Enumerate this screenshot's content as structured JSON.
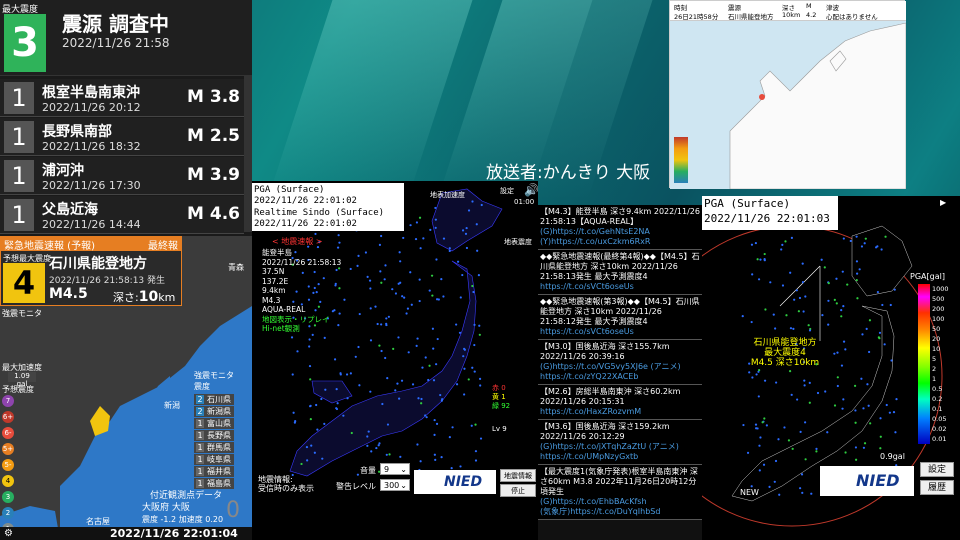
{
  "left": {
    "max_label": "最大震度",
    "max_intensity": "3",
    "title": "震源 調査中",
    "time": "2022/11/26 21:58",
    "quakes": [
      {
        "int": "1",
        "name": "根室半島南東沖",
        "time": "2022/11/26 20:12",
        "mag": "M 3.8"
      },
      {
        "int": "1",
        "name": "長野県南部",
        "time": "2022/11/26 18:32",
        "mag": "M 2.5"
      },
      {
        "int": "1",
        "name": "浦河沖",
        "time": "2022/11/26 17:30",
        "mag": "M 3.9"
      },
      {
        "int": "1",
        "name": "父島近海",
        "time": "2022/11/26 14:44",
        "mag": "M 4.6"
      }
    ],
    "eew": {
      "header": "緊急地震速報 (予報)",
      "final": "最終報",
      "label": "予想最大震度",
      "int": "4",
      "area": "石川県能登地方",
      "time": "2022/11/26 21:58:13 発生",
      "mag": "M4.5",
      "depth_label": "深さ:",
      "depth": "10",
      "depth_unit": "km"
    },
    "strong_label": "強震モニタ",
    "max_accel_label": "最大加速度",
    "max_accel": "1.09 gal",
    "pred_label": "予想震度",
    "scale": [
      "7",
      "6+",
      "6-",
      "5+",
      "5-",
      "4",
      "3",
      "2",
      "1"
    ],
    "scale_colors": [
      "#8e44ad",
      "#c0392b",
      "#e74c3c",
      "#e67e22",
      "#f39c12",
      "#f1c40f",
      "#27ae60",
      "#2980b9",
      "#7f8c8d"
    ],
    "monitor_title": "強震モニタ震度",
    "monitor": [
      {
        "n": "2",
        "name": "石川県",
        "c": "#2980b9"
      },
      {
        "n": "2",
        "name": "新潟県",
        "c": "#2980b9"
      },
      {
        "n": "1",
        "name": "富山県",
        "c": "#555"
      },
      {
        "n": "1",
        "name": "長野県",
        "c": "#555"
      },
      {
        "n": "1",
        "name": "群馬県",
        "c": "#555"
      },
      {
        "n": "1",
        "name": "岐阜県",
        "c": "#555"
      },
      {
        "n": "1",
        "name": "福井県",
        "c": "#555"
      },
      {
        "n": "1",
        "name": "福島県",
        "c": "#555"
      }
    ],
    "near_label": "付近観測点データ",
    "osaka": "大阪府 大阪",
    "osaka_vals": "震度 -1.2 加速度 0.20",
    "osaka_zero": "0",
    "place_aomori": "青森",
    "place_niigata": "新潟",
    "place_nagoya": "名古屋",
    "footer": "2022/11/26 22:01:04"
  },
  "center": {
    "pga": "PGA (Surface)",
    "pga_time": "2022/11/26 22:01:02",
    "rt": "Realtime Sindo (Surface)",
    "rt_time": "2022/11/26 22:01:02",
    "badge": "< 地震速報 >",
    "info": [
      "能登半島",
      "2022/11/26 21:58:13",
      "37.5N",
      "137.2E",
      "9.4km",
      "M4.3",
      "AQUA-REAL"
    ],
    "green": [
      "地図表示・リプレイ",
      "Hi-net観測"
    ],
    "label_map": "地表加速度",
    "label_sindo": "地表震度",
    "setting": "設定",
    "clock": "01:00",
    "red": "赤 0",
    "yellow": "黄 1",
    "green_count": "緑 92",
    "lv": "Lv 9",
    "jishin": "地震情報:",
    "jushin": "受信時のみ表示",
    "volume_label": "音量",
    "volume": "9",
    "warn_label": "警告レベル",
    "warn": "300",
    "info_btn": "地震情報",
    "stop_btn": "停止",
    "nied": "NIED"
  },
  "tweets": [
    {
      "t": "【M4.3】能登半島 深さ9.4km 2022/11/26 21:58:13【AQUA-REAL】",
      "links": [
        "(G)https://t.co/GehNtsE2NA",
        "(Y)https://t.co/uxCzkm6RxR"
      ]
    },
    {
      "t": "◆◆緊急地震速報(最終第4報)◆◆【M4.5】石川県能登地方 深さ10km 2022/11/26 21:58:13発生 最大予測震度4",
      "links": [
        "https://t.co/sVCt6oseUs"
      ]
    },
    {
      "t": "◆◆緊急地震速報(第3報)◆◆【M4.5】石川県能登地方 深さ10km 2022/11/26 21:58:12発生 最大予測震度4",
      "links": [
        "https://t.co/sVCt6oseUs"
      ]
    },
    {
      "t": "【M3.0】国後島近海 深さ155.7km 2022/11/26 20:39:16",
      "links": [
        "(G)https://t.co/VG5vy5XJ6e (アニメ)",
        "https://t.co/zYQ22XACEb"
      ]
    },
    {
      "t": "【M2.6】房総半島南東沖 深さ60.2km 2022/11/26 20:15:31",
      "links": [
        "https://t.co/HaxZRozvmM"
      ]
    },
    {
      "t": "【M3.6】国後島近海 深さ159.2km 2022/11/26 20:12:29",
      "links": [
        "(G)https://t.co/jXTqhZaZtU (アニメ)",
        "https://t.co/UMpNzyGxtb"
      ]
    },
    {
      "t": "【最大震度1(気象庁発表)根室半島南東沖 深さ60km M3.8 2022年11月26日20時12分頃発生",
      "links": [
        "(G)https://t.co/EhbBAcKfsh",
        "(気象庁)https://t.co/DuYqIhbSd"
      ]
    }
  ],
  "right": {
    "pga": "PGA (Surface)",
    "pga_time": "2022/11/26 22:01:03",
    "legend_title": "PGA[gal]",
    "legend_vals": [
      "1000",
      "500",
      "200",
      "100",
      "50",
      "20",
      "10",
      "5",
      "2",
      "1",
      "0.5",
      "0.2",
      "0.1",
      "0.05",
      "0.02",
      "0.01"
    ],
    "epi": "石川県能登地方",
    "epi2": "最大震度4",
    "epi3": "M4.5 深さ10km",
    "pga_val": "0.9gal",
    "new": "NEW",
    "nied": "NIED",
    "btn_setting": "設定",
    "btn_history": "履歴"
  },
  "topmap": {
    "cols": [
      "26日21時58分",
      "石川県能登地方",
      "10km",
      "4.2",
      "心配はありません"
    ],
    "heads": [
      "時刻",
      "震源",
      "深さ",
      "M",
      "津波"
    ]
  },
  "broadcaster": "放送者:かんきり 大阪"
}
